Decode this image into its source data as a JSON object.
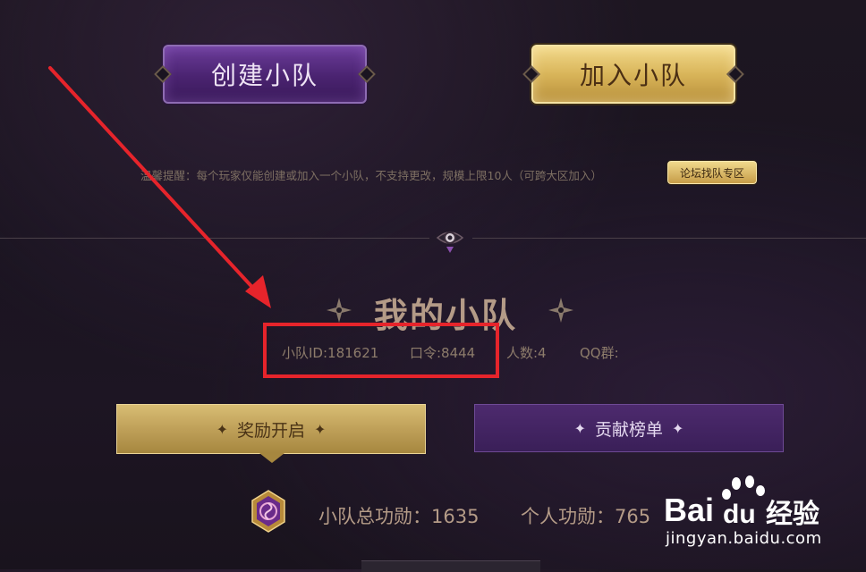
{
  "buttons": {
    "create_team": "创建小队",
    "join_team": "加入小队",
    "forum_zone": "论坛找队专区",
    "reward": "奖励开启",
    "ranking": "贡献榜单"
  },
  "hint_text": "温馨提醒：每个玩家仅能创建或加入一个小队，不支持更改，规模上限10人（可跨大区加入）",
  "team": {
    "title": "我的小队",
    "id_text": "小队ID:181621",
    "code_text": "口令:8444",
    "members_text": "人数:4",
    "qq_text": "QQ群:"
  },
  "merit": {
    "team_total": "小队总功勋：1635",
    "personal": "个人功勋：765"
  },
  "watermark": {
    "brand_bai": "Bai",
    "brand_du": "du",
    "brand_jingyan": "经验",
    "url": "jingyan.baidu.com"
  },
  "colors": {
    "annotation_red": "#e6242b",
    "gold": "#d9b55a",
    "purple": "#4a2370"
  }
}
